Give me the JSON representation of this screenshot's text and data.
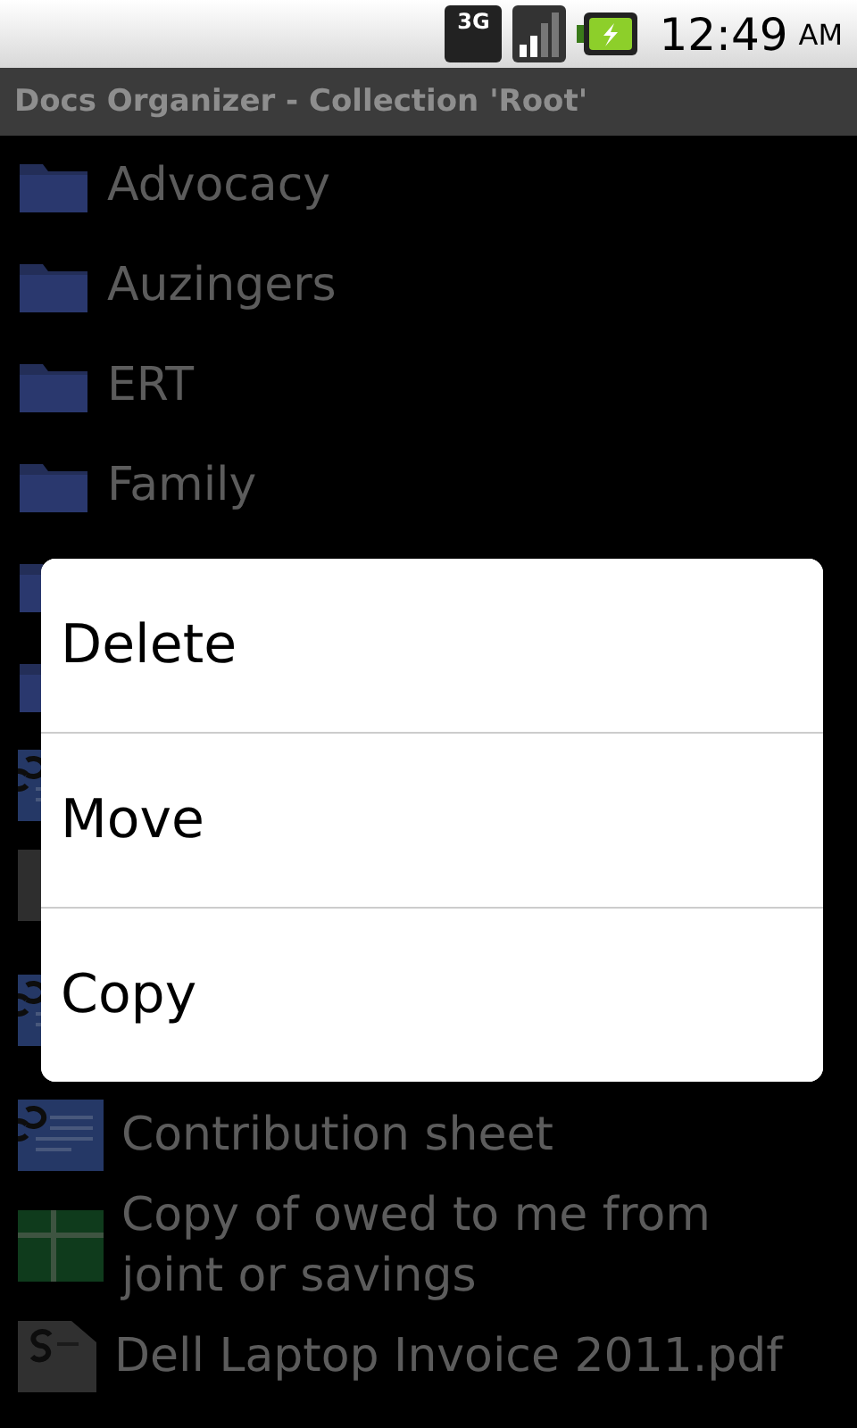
{
  "status_bar": {
    "network": "3G",
    "time": "12:49",
    "ampm": "AM"
  },
  "title_bar": {
    "title": "Docs Organizer - Collection 'Root'"
  },
  "items": [
    {
      "kind": "folder",
      "label": "Advocacy"
    },
    {
      "kind": "folder",
      "label": "Auzingers"
    },
    {
      "kind": "folder",
      "label": "ERT"
    },
    {
      "kind": "folder",
      "label": "Family"
    },
    {
      "kind": "folder"
    },
    {
      "kind": "folder"
    },
    {
      "kind": "text-doc"
    },
    {
      "kind": "generic"
    },
    {
      "kind": "text-doc"
    },
    {
      "kind": "text-doc",
      "label": "Contribution sheet"
    },
    {
      "kind": "spreadsheet",
      "label": "Copy of owed to me from joint or savings"
    },
    {
      "kind": "pdf",
      "label": "Dell Laptop Invoice 2011.pdf"
    }
  ],
  "context_menu": {
    "items": [
      "Delete",
      "Move",
      "Copy"
    ]
  }
}
